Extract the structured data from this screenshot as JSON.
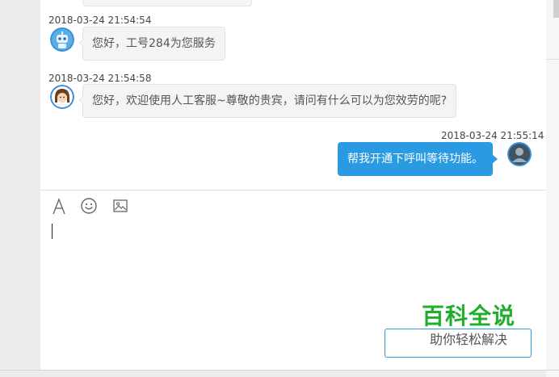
{
  "chat": {
    "messages": [
      {
        "time": "2018-03-24 21:54:54",
        "text": "您好，工号284为您服务",
        "sender": "robot",
        "avatar_icon": "robot-avatar-icon"
      },
      {
        "time": "2018-03-24 21:54:58",
        "text": "您好，欢迎使用人工客服~尊敬的贵宾，请问有什么可以为您效劳的呢?",
        "sender": "agent",
        "avatar_icon": "agent-avatar-icon"
      },
      {
        "time": "2018-03-24 21:55:14",
        "text": "帮我开通下呼叫等待功能。",
        "sender": "user",
        "avatar_icon": "user-avatar-icon"
      }
    ]
  },
  "toolbar": {
    "icons": [
      "font-icon",
      "emoji-icon",
      "image-icon"
    ]
  },
  "watermark": {
    "title": "百科全说",
    "subtitle": "助你轻松解决"
  },
  "colors": {
    "accent": "#2a9be3",
    "watermark_green": "#1fae2b"
  }
}
